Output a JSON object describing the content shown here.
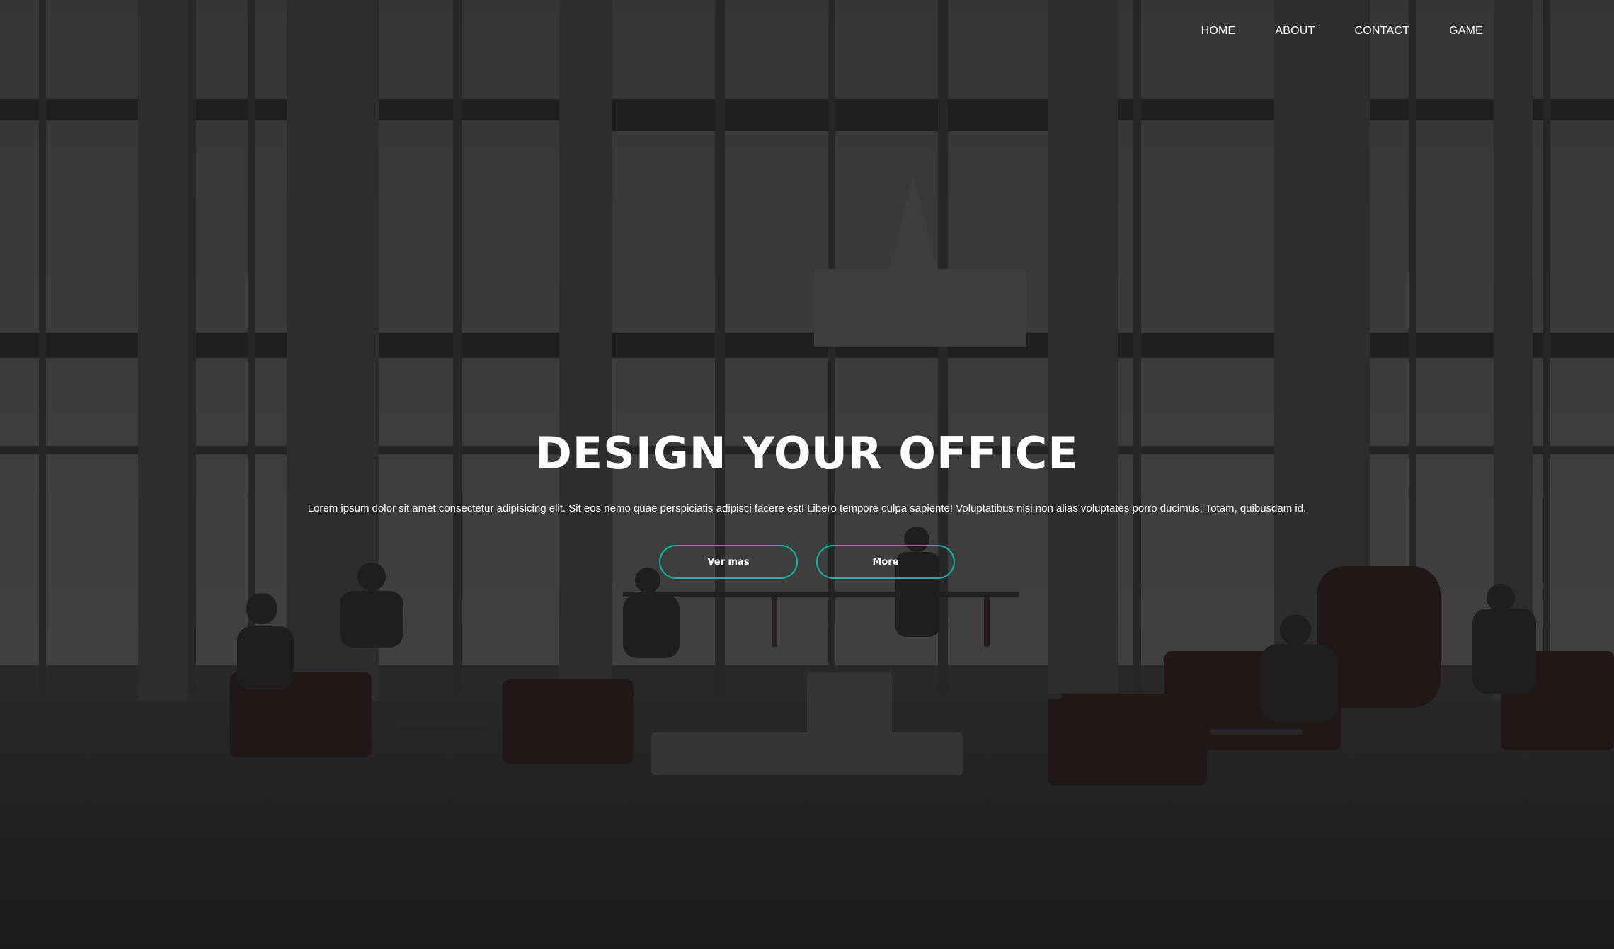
{
  "nav": {
    "items": [
      {
        "label": "HOME"
      },
      {
        "label": "ABOUT"
      },
      {
        "label": "CONTACT"
      },
      {
        "label": "GAME"
      }
    ]
  },
  "hero": {
    "title": "DESIGN YOUR OFFICE",
    "description": "Lorem ipsum dolor sit amet consectetur adipisicing elit. Sit eos nemo quae perspiciatis adipisci facere est! Libero tempore culpa sapiente! Voluptatibus nisi non alias voluptates porro ducimus. Totam, quibusdam id.",
    "primary_button": "Ver mas",
    "secondary_button": "More",
    "accent_color": "#17b3a3",
    "background_image": "office-lobby-photo"
  }
}
